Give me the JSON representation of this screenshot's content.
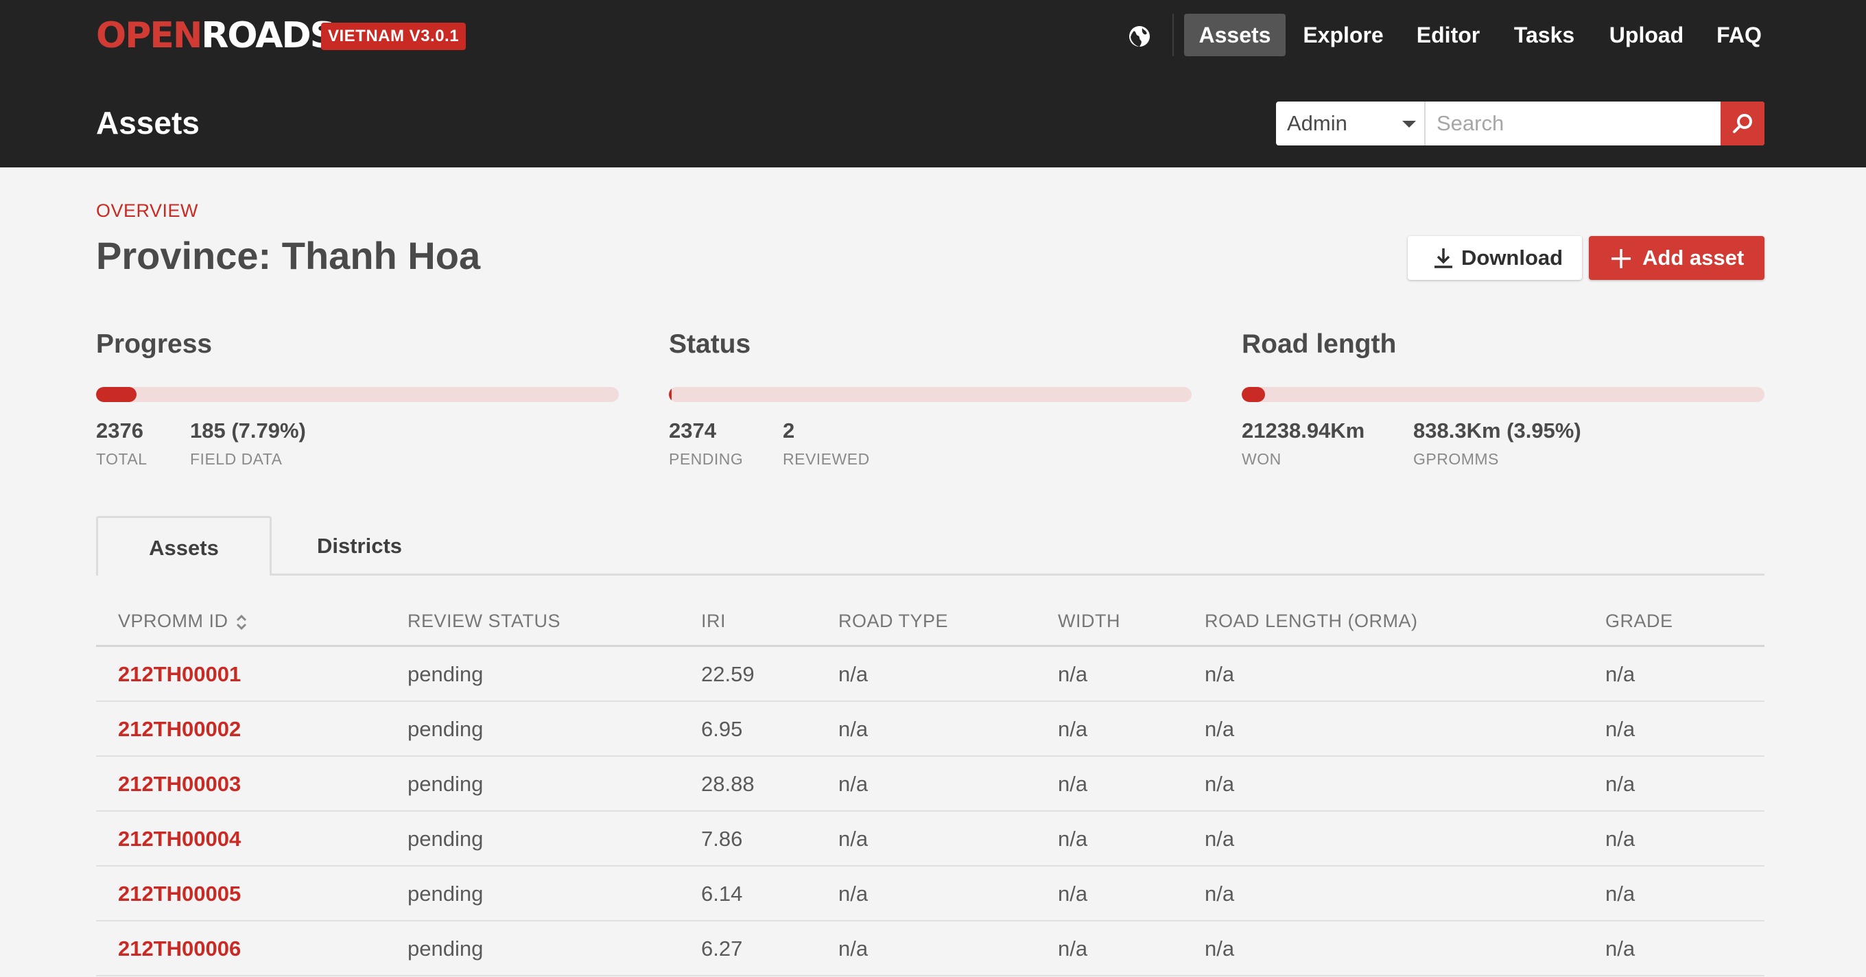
{
  "brand": {
    "logo_open": "OPEN",
    "logo_roads": "ROADS",
    "version": "VIETNAM V3.0.1",
    "accent": "#c92a23"
  },
  "nav": {
    "items": [
      {
        "label": "Assets",
        "active": true
      },
      {
        "label": "Explore"
      },
      {
        "label": "Editor"
      },
      {
        "label": "Tasks"
      },
      {
        "label": "Upload"
      },
      {
        "label": "FAQ"
      }
    ]
  },
  "header": {
    "title": "Assets",
    "admin_select": "Admin",
    "search_placeholder": "Search"
  },
  "overview": {
    "label": "OVERVIEW",
    "title": "Province: Thanh Hoa",
    "download_label": "Download",
    "add_label": "Add asset"
  },
  "stats": {
    "progress": {
      "title": "Progress",
      "fill_fraction": 0.0779,
      "values": [
        {
          "value": "2376",
          "label": "TOTAL"
        },
        {
          "value": "185 (7.79%)",
          "label": "FIELD DATA"
        }
      ]
    },
    "status": {
      "title": "Status",
      "fill_fraction": 0.0008,
      "values": [
        {
          "value": "2374",
          "label": "PENDING"
        },
        {
          "value": "2",
          "label": "REVIEWED"
        }
      ]
    },
    "road_length": {
      "title": "Road length",
      "fill_fraction": 0.0395,
      "values": [
        {
          "value": "21238.94Km",
          "label": "WON"
        },
        {
          "value": "838.3Km (3.95%)",
          "label": "GPROMMS"
        }
      ]
    }
  },
  "tabs": [
    {
      "label": "Assets",
      "active": true
    },
    {
      "label": "Districts"
    }
  ],
  "table": {
    "headers": [
      "VPROMM ID",
      "REVIEW STATUS",
      "IRI",
      "ROAD TYPE",
      "WIDTH",
      "ROAD LENGTH (ORMA)",
      "GRADE"
    ],
    "rows": [
      [
        "212TH00001",
        "pending",
        "22.59",
        "n/a",
        "n/a",
        "n/a",
        "n/a"
      ],
      [
        "212TH00002",
        "pending",
        "6.95",
        "n/a",
        "n/a",
        "n/a",
        "n/a"
      ],
      [
        "212TH00003",
        "pending",
        "28.88",
        "n/a",
        "n/a",
        "n/a",
        "n/a"
      ],
      [
        "212TH00004",
        "pending",
        "7.86",
        "n/a",
        "n/a",
        "n/a",
        "n/a"
      ],
      [
        "212TH00005",
        "pending",
        "6.14",
        "n/a",
        "n/a",
        "n/a",
        "n/a"
      ],
      [
        "212TH00006",
        "pending",
        "6.27",
        "n/a",
        "n/a",
        "n/a",
        "n/a"
      ]
    ]
  }
}
